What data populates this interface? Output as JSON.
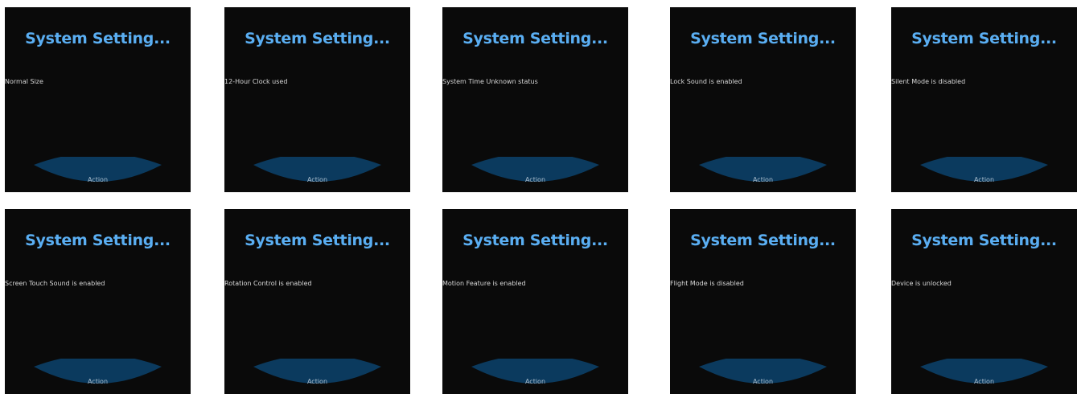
{
  "screens": [
    {
      "title": "System Setting...",
      "status": "Normal Size",
      "action": "Action"
    },
    {
      "title": "System Setting...",
      "status": "12-Hour Clock used",
      "action": "Action"
    },
    {
      "title": "System Setting...",
      "status": "System Time Unknown status",
      "action": "Action"
    },
    {
      "title": "System Setting...",
      "status": "Lock Sound is enabled",
      "action": "Action"
    },
    {
      "title": "System Setting...",
      "status": "Silent Mode is disabled",
      "action": "Action"
    },
    {
      "title": "System Setting...",
      "status": "Screen Touch Sound is enabled",
      "action": "Action"
    },
    {
      "title": "System Setting...",
      "status": "Rotation Control is enabled",
      "action": "Action"
    },
    {
      "title": "System Setting...",
      "status": "Motion Feature is enabled",
      "action": "Action"
    },
    {
      "title": "System Setting...",
      "status": "Flight Mode is disabled",
      "action": "Action"
    },
    {
      "title": "System Setting...",
      "status": "Device is unlocked",
      "action": "Action"
    }
  ],
  "colors": {
    "screen_background": "#0a0a0a",
    "title": "#5aaef2",
    "status_text": "#d8d8d8",
    "action_button": "#0b3a5e",
    "action_text": "#a9bccc"
  }
}
